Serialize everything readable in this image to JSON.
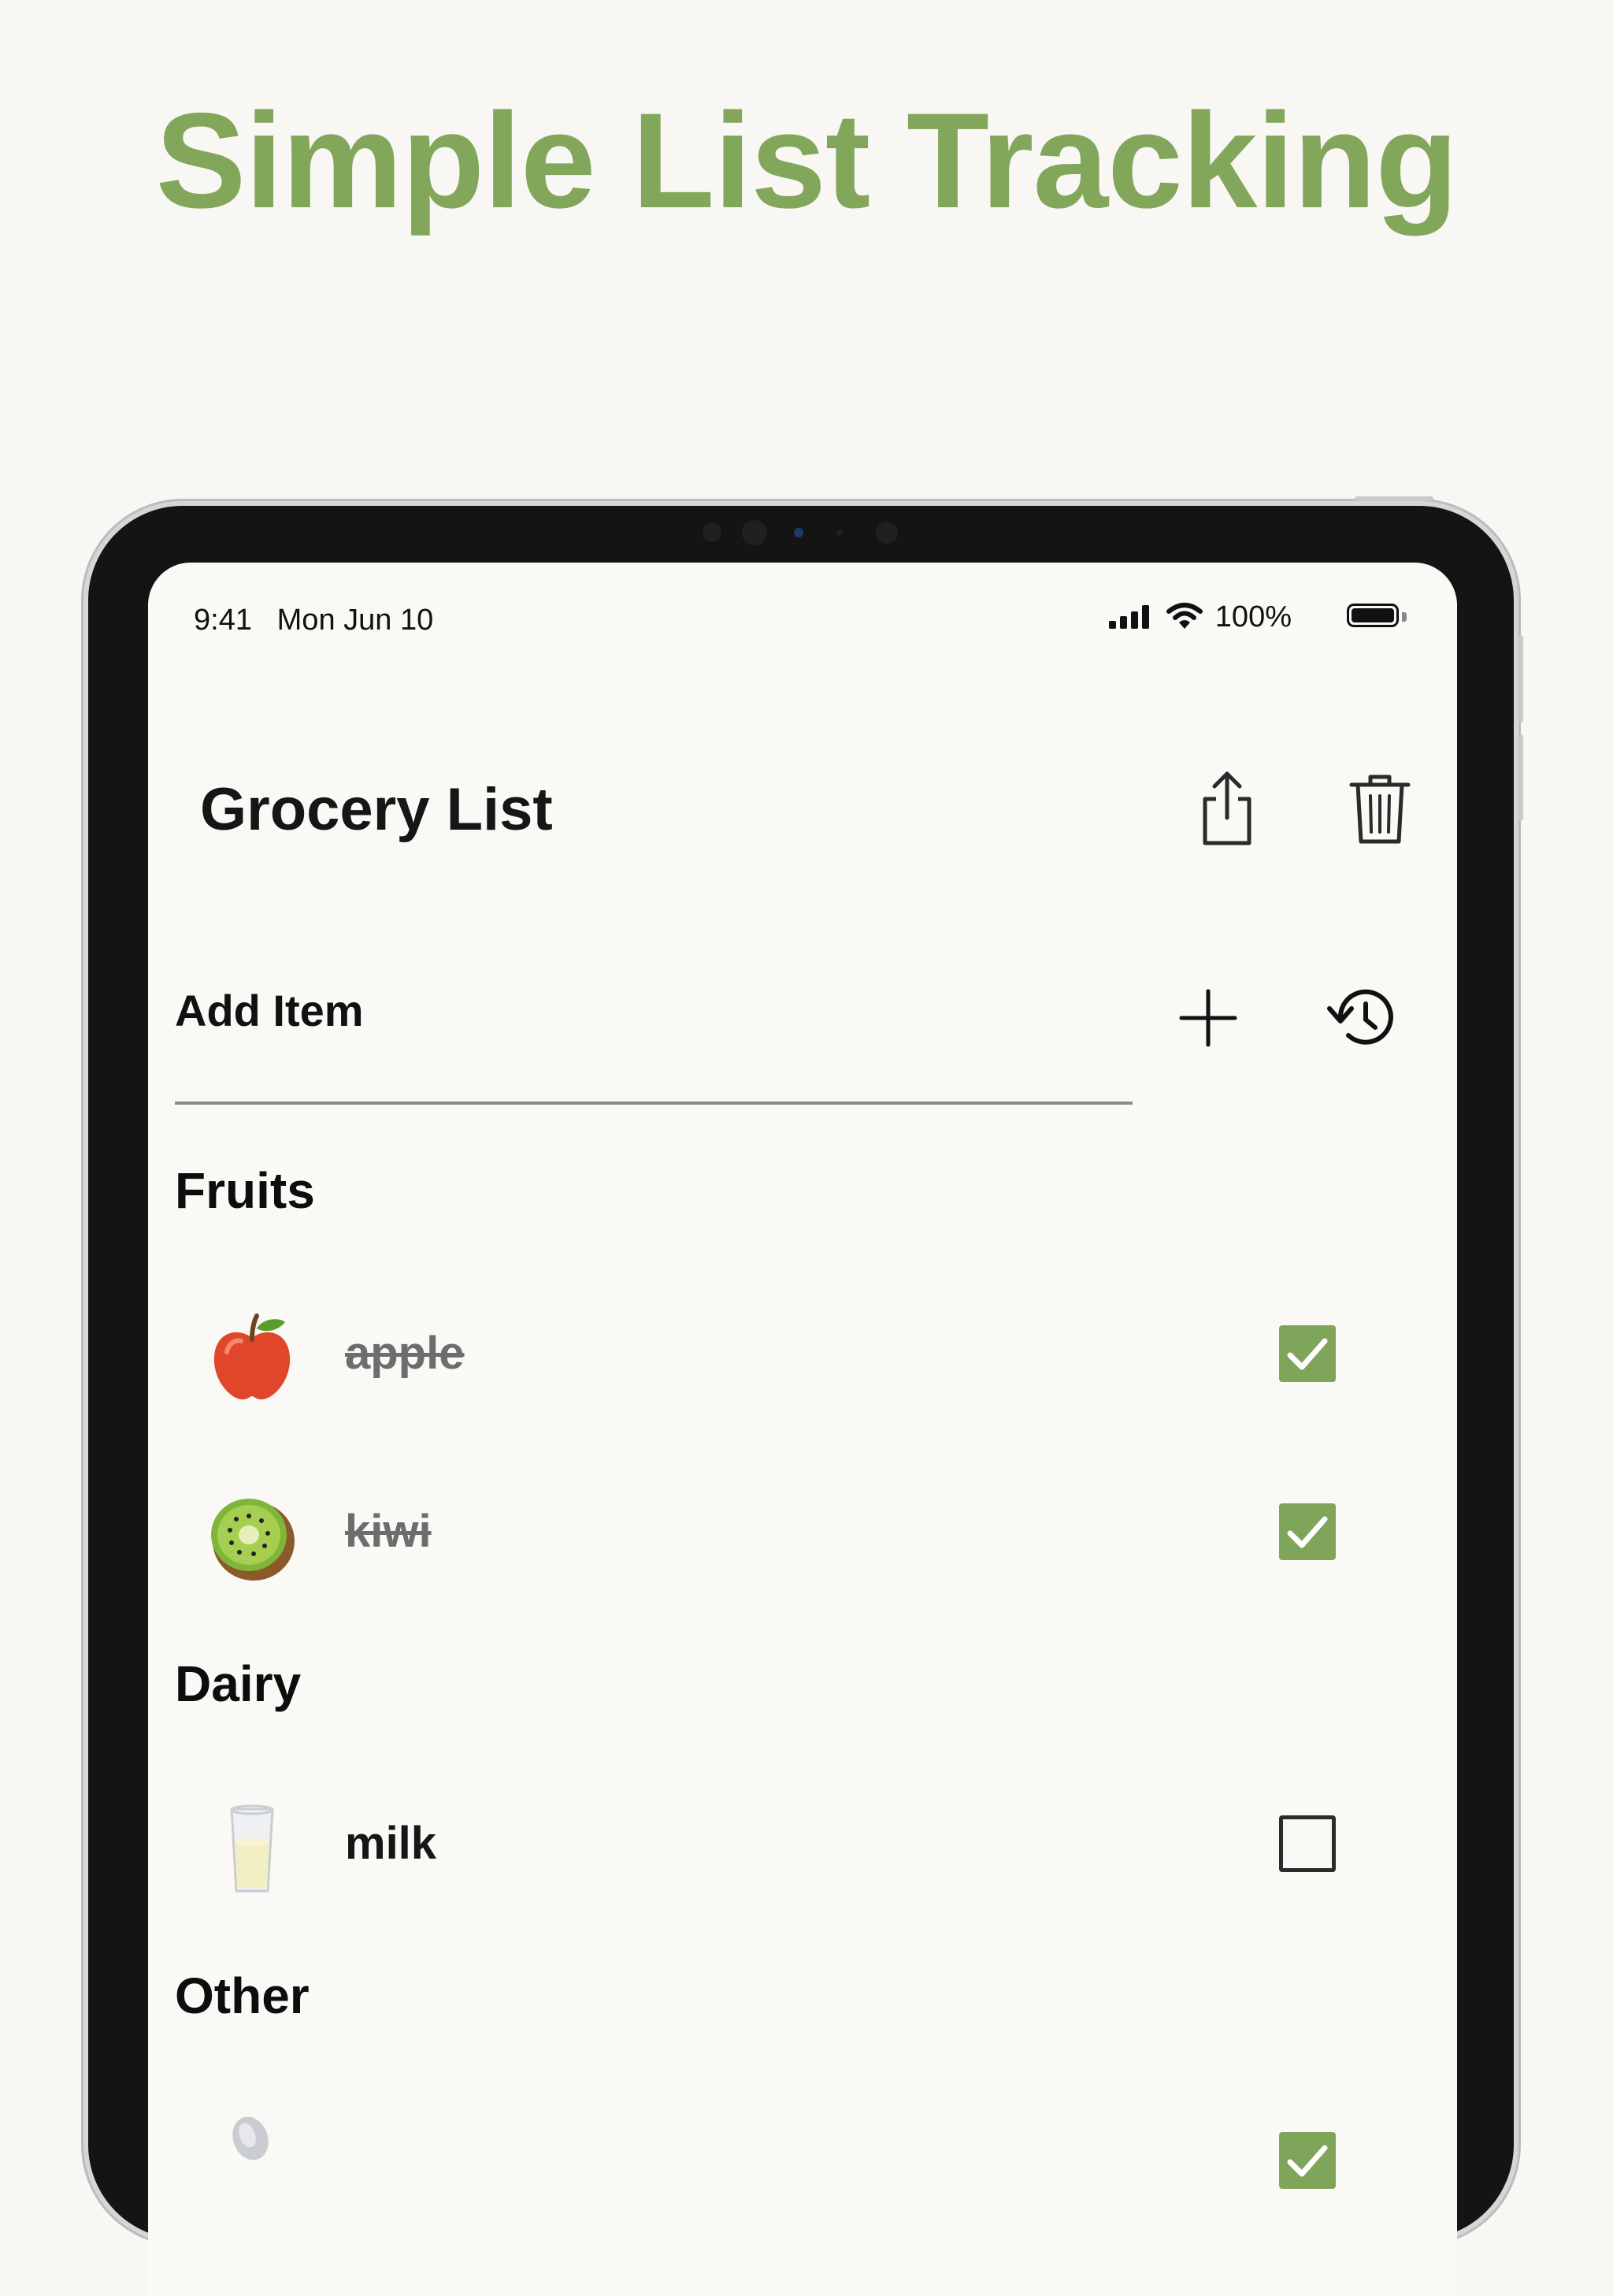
{
  "headline": "Simple List Tracking",
  "colors": {
    "accent": "#82a75b",
    "check": "#7fa55b",
    "background": "#f8f7f3"
  },
  "status_bar": {
    "time": "9:41",
    "date": "Mon Jun 10",
    "battery": "100%"
  },
  "app": {
    "title": "Grocery List",
    "toolbar": {
      "share_icon": "share-icon",
      "delete_icon": "trash-icon"
    },
    "add_item": {
      "label": "Add Item",
      "add_icon": "plus-icon",
      "history_icon": "history-icon"
    },
    "sections": [
      {
        "name": "Fruits",
        "items": [
          {
            "emoji": "apple",
            "text": "apple",
            "checked": true
          },
          {
            "emoji": "kiwi",
            "text": "kiwi",
            "checked": true
          }
        ]
      },
      {
        "name": "Dairy",
        "items": [
          {
            "emoji": "milk-glass",
            "text": "milk",
            "checked": false
          }
        ]
      },
      {
        "name": "Other",
        "items": [
          {
            "emoji": "spoon",
            "text": "",
            "checked": true
          }
        ]
      }
    ]
  }
}
